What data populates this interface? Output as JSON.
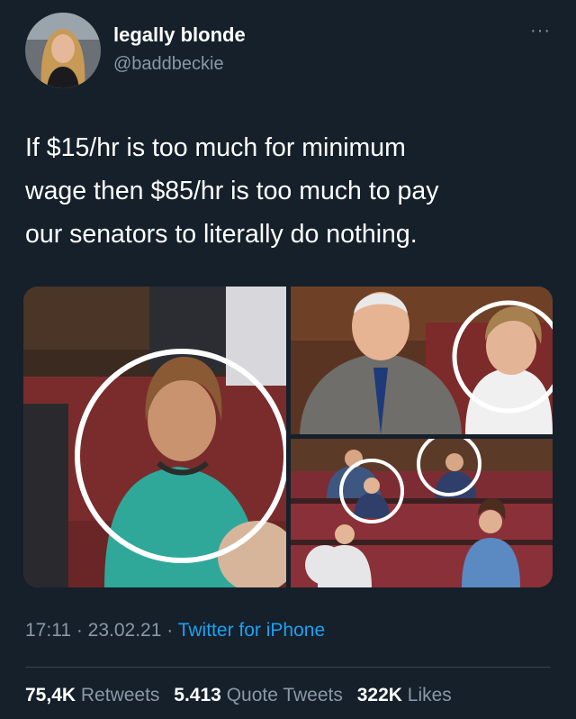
{
  "header": {
    "display_name": "legally blonde",
    "handle": "@baddbeckie",
    "more_label": "···"
  },
  "tweet": {
    "line1": "If $15/hr is too much for minimum",
    "line2": "wage then $85/hr is too much to pay",
    "line3": "our senators to literally do nothing."
  },
  "meta": {
    "time": "17:11",
    "separator1": " · ",
    "date": "23.02.21",
    "separator2": " · ",
    "source": "Twitter for iPhone"
  },
  "stats": {
    "retweets_count": "75,4K",
    "retweets_label": "Retweets",
    "quotes_count": "5.413",
    "quotes_label": "Quote Tweets",
    "likes_count": "322K",
    "likes_label": "Likes"
  },
  "colors": {
    "background": "#15202b",
    "text": "#ffffff",
    "secondary": "#8b98a5",
    "link": "#1da1f2",
    "divider": "#38444d"
  }
}
